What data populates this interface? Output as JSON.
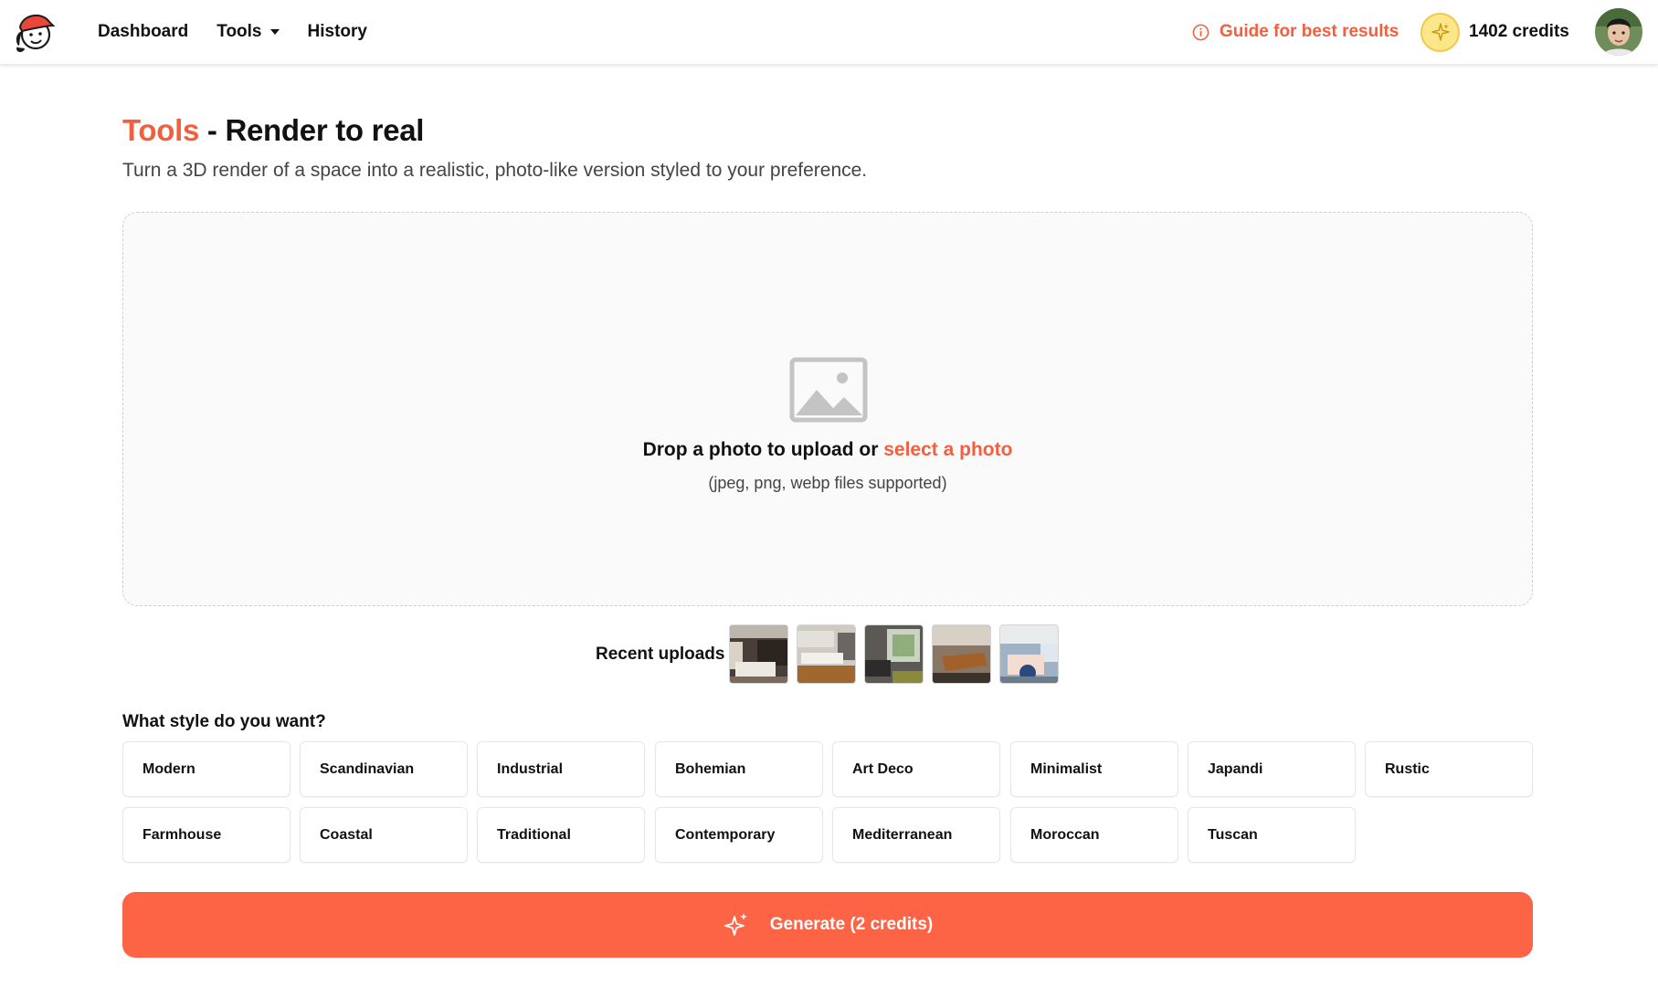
{
  "header": {
    "nav": [
      {
        "label": "Dashboard"
      },
      {
        "label": "Tools"
      },
      {
        "label": "History"
      }
    ],
    "guide_label": "Guide for best results",
    "credits_label": "1402 credits"
  },
  "page": {
    "title_accent": "Tools",
    "title_rest": " - Render to real",
    "subtitle": "Turn a 3D render of a space into a realistic, photo-like version styled to your preference."
  },
  "upload": {
    "prompt": "Drop a photo to upload or ",
    "link": "select a photo",
    "formats": "(jpeg, png, webp files supported)"
  },
  "recent": {
    "label": "Recent uploads",
    "thumbnails": [
      {
        "icon": "bedroom-dark-photo"
      },
      {
        "icon": "kitchen-photo"
      },
      {
        "icon": "living-room-photo"
      },
      {
        "icon": "dining-photo"
      },
      {
        "icon": "bedroom-light-photo"
      }
    ]
  },
  "styles": {
    "question": "What style do you want?",
    "options": [
      "Modern",
      "Scandinavian",
      "Industrial",
      "Bohemian",
      "Art Deco",
      "Minimalist",
      "Japandi",
      "Rustic",
      "Farmhouse",
      "Coastal",
      "Traditional",
      "Contemporary",
      "Mediterranean",
      "Moroccan",
      "Tuscan"
    ]
  },
  "generate": {
    "label": "Generate (2 credits)"
  },
  "colors": {
    "accent": "#f25f3f",
    "button": "#fd6446",
    "coin": "#fbe78a"
  }
}
